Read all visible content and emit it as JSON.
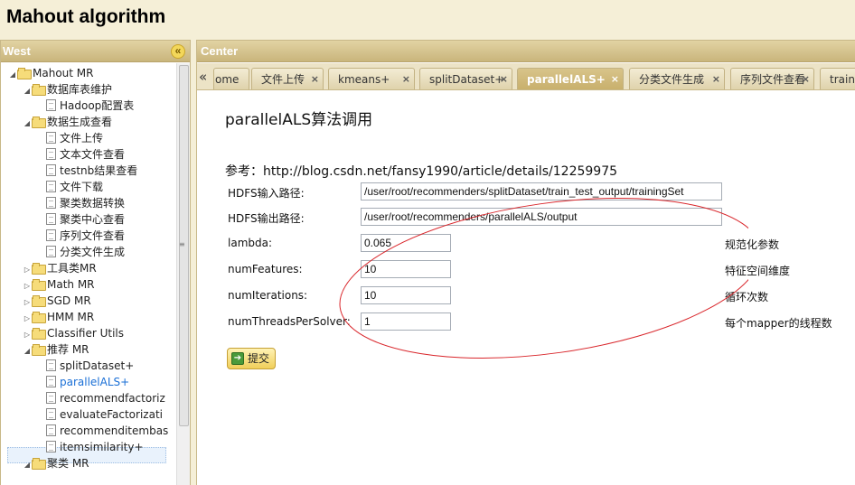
{
  "app": {
    "title": "Mahout algorithm"
  },
  "west": {
    "title": "West",
    "collapse_glyph": "«",
    "tree": [
      {
        "label": "Mahout MR",
        "type": "folder",
        "expanded": true
      },
      {
        "label": "数据库表维护",
        "type": "folder",
        "expanded": true
      },
      {
        "label": "Hadoop配置表",
        "type": "file"
      },
      {
        "label": "数据生成查看",
        "type": "folder",
        "expanded": true
      },
      {
        "label": "文件上传",
        "type": "file"
      },
      {
        "label": "文本文件查看",
        "type": "file"
      },
      {
        "label": "testnb结果查看",
        "type": "file"
      },
      {
        "label": "文件下载",
        "type": "file"
      },
      {
        "label": "聚类数据转换",
        "type": "file"
      },
      {
        "label": "聚类中心查看",
        "type": "file"
      },
      {
        "label": "序列文件查看",
        "type": "file"
      },
      {
        "label": "分类文件生成",
        "type": "file"
      },
      {
        "label": "工具类MR",
        "type": "folder",
        "expanded": false
      },
      {
        "label": "Math MR",
        "type": "folder",
        "expanded": false
      },
      {
        "label": "SGD MR",
        "type": "folder",
        "expanded": false
      },
      {
        "label": "HMM MR",
        "type": "folder",
        "expanded": false
      },
      {
        "label": "Classifier Utils",
        "type": "folder",
        "expanded": false
      },
      {
        "label": "推荐 MR",
        "type": "folder",
        "expanded": true
      },
      {
        "label": "splitDataset+",
        "type": "file"
      },
      {
        "label": "parallelALS+",
        "type": "file",
        "selected": true
      },
      {
        "label": "recommendfactoriz",
        "type": "file"
      },
      {
        "label": "evaluateFactorizati",
        "type": "file"
      },
      {
        "label": "recommenditembas",
        "type": "file"
      },
      {
        "label": "itemsimilarity+",
        "type": "file"
      },
      {
        "label": "聚类 MR",
        "type": "folder",
        "expanded": true
      }
    ]
  },
  "center": {
    "title": "Center",
    "tab_scroll_glyph": "«",
    "tabs": [
      {
        "label": "ome",
        "active": false,
        "closable": false
      },
      {
        "label": "文件上传",
        "active": false,
        "closable": true
      },
      {
        "label": "kmeans+",
        "active": false,
        "closable": true
      },
      {
        "label": "splitDataset+",
        "active": false,
        "closable": true
      },
      {
        "label": "parallelALS+",
        "active": true,
        "closable": true
      },
      {
        "label": "分类文件生成",
        "active": false,
        "closable": true
      },
      {
        "label": "序列文件查看",
        "active": false,
        "closable": true
      },
      {
        "label": "traini",
        "active": false,
        "closable": false
      }
    ],
    "close_glyph": "×"
  },
  "form": {
    "title": "parallelALS算法调用",
    "reference": "参考：http://blog.csdn.net/fansy1990/article/details/12259975",
    "fields": [
      {
        "label": "HDFS输入路径:",
        "value": "/user/root/recommenders/splitDataset/train_test_output/trainingSet",
        "hint": ""
      },
      {
        "label": "HDFS输出路径:",
        "value": "/user/root/recommenders/parallelALS/output",
        "hint": ""
      },
      {
        "label": "lambda:",
        "value": "0.065",
        "hint": "规范化参数"
      },
      {
        "label": "numFeatures:",
        "value": "10",
        "hint": "特征空间维度"
      },
      {
        "label": "numIterations:",
        "value": "10",
        "hint": "循环次数"
      },
      {
        "label": "numThreadsPerSolver:",
        "value": "1",
        "hint": "每个mapper的线程数"
      }
    ],
    "submit_label": "提交"
  },
  "colors": {
    "header_gold": "#c9b57c",
    "selected_text": "#1a6fd6",
    "annotation_red": "#d9262b"
  }
}
